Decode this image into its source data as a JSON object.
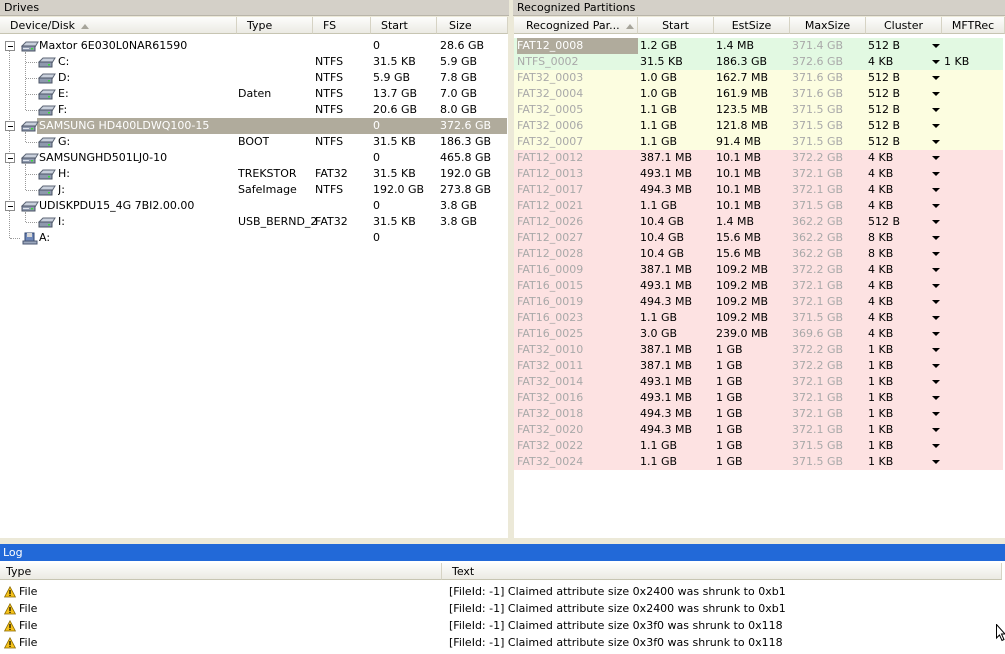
{
  "drives_panel": {
    "title": "Drives",
    "columns": [
      "Device/Disk",
      "Type",
      "FS",
      "Start",
      "Size"
    ],
    "rows": [
      {
        "level": 0,
        "name": "Maxtor 6E030L0NAR61590",
        "type": "",
        "fs": "",
        "start": "0",
        "size": "28.6 GB",
        "kind": "disk",
        "selected": false
      },
      {
        "level": 1,
        "name": "C:",
        "type": "",
        "fs": "NTFS",
        "start": "31.5 KB",
        "size": "5.9 GB",
        "kind": "part",
        "selected": false
      },
      {
        "level": 1,
        "name": "D:",
        "type": "",
        "fs": "NTFS",
        "start": "5.9 GB",
        "size": "7.8 GB",
        "kind": "part",
        "selected": false
      },
      {
        "level": 1,
        "name": "E:",
        "type": "Daten",
        "fs": "NTFS",
        "start": "13.7 GB",
        "size": "7.0 GB",
        "kind": "part",
        "selected": false
      },
      {
        "level": 1,
        "name": "F:",
        "type": "",
        "fs": "NTFS",
        "start": "20.6 GB",
        "size": "8.0 GB",
        "kind": "part",
        "selected": false
      },
      {
        "level": 0,
        "name": "SAMSUNG HD400LDWQ100-15",
        "type": "",
        "fs": "",
        "start": "0",
        "size": "372.6 GB",
        "kind": "disk",
        "selected": true
      },
      {
        "level": 1,
        "name": "G:",
        "type": "BOOT",
        "fs": "NTFS",
        "start": "31.5 KB",
        "size": "186.3 GB",
        "kind": "part",
        "selected": false
      },
      {
        "level": 0,
        "name": "SAMSUNGHD501LJ0-10",
        "type": "",
        "fs": "",
        "start": "0",
        "size": "465.8 GB",
        "kind": "disk",
        "selected": false
      },
      {
        "level": 1,
        "name": "H:",
        "type": "TREKSTOR",
        "fs": "FAT32",
        "start": "31.5 KB",
        "size": "192.0 GB",
        "kind": "part",
        "selected": false
      },
      {
        "level": 1,
        "name": "J:",
        "type": "SafeImage",
        "fs": "NTFS",
        "start": "192.0 GB",
        "size": "273.8 GB",
        "kind": "part",
        "selected": false
      },
      {
        "level": 0,
        "name": "UDISKPDU15_4G 7BI2.00.00",
        "type": "",
        "fs": "",
        "start": "0",
        "size": "3.8 GB",
        "kind": "disk",
        "selected": false
      },
      {
        "level": 1,
        "name": "I:",
        "type": "USB_BERND_2",
        "fs": "FAT32",
        "start": "31.5 KB",
        "size": "3.8 GB",
        "kind": "part",
        "selected": false
      },
      {
        "level": 0,
        "name": "A:",
        "type": "",
        "fs": "",
        "start": "0",
        "size": "",
        "kind": "floppy",
        "selected": false
      }
    ]
  },
  "partitions_panel": {
    "title": "Recognized Partitions",
    "columns": [
      "Recognized Par...",
      "Start",
      "EstSize",
      "MaxSize",
      "Cluster",
      "MFTRec"
    ],
    "colors": {
      "green": "#e2f9e2",
      "yellow": "#fcfde0",
      "red": "#fde2e2",
      "selected": "#b0ab9c"
    },
    "rows": [
      {
        "name": "FAT12_0008",
        "start": "1.2 GB",
        "est": "1.4 MB",
        "max": "371.4 GB",
        "cluster": "512 B",
        "mft": "",
        "color": "green",
        "selected": true
      },
      {
        "name": "NTFS_0002",
        "start": "31.5 KB",
        "est": "186.3 GB",
        "max": "372.6 GB",
        "cluster": "4 KB",
        "mft": "1 KB",
        "color": "green",
        "selected": false
      },
      {
        "name": "FAT32_0003",
        "start": "1.0 GB",
        "est": "162.7 MB",
        "max": "371.6 GB",
        "cluster": "512 B",
        "mft": "",
        "color": "yellow",
        "selected": false
      },
      {
        "name": "FAT32_0004",
        "start": "1.0 GB",
        "est": "161.9 MB",
        "max": "371.6 GB",
        "cluster": "512 B",
        "mft": "",
        "color": "yellow",
        "selected": false
      },
      {
        "name": "FAT32_0005",
        "start": "1.1 GB",
        "est": "123.5 MB",
        "max": "371.5 GB",
        "cluster": "512 B",
        "mft": "",
        "color": "yellow",
        "selected": false
      },
      {
        "name": "FAT32_0006",
        "start": "1.1 GB",
        "est": "121.8 MB",
        "max": "371.5 GB",
        "cluster": "512 B",
        "mft": "",
        "color": "yellow",
        "selected": false
      },
      {
        "name": "FAT32_0007",
        "start": "1.1 GB",
        "est": "91.4 MB",
        "max": "371.5 GB",
        "cluster": "512 B",
        "mft": "",
        "color": "yellow",
        "selected": false
      },
      {
        "name": "FAT12_0012",
        "start": "387.1 MB",
        "est": "10.1 MB",
        "max": "372.2 GB",
        "cluster": "4 KB",
        "mft": "",
        "color": "red",
        "selected": false
      },
      {
        "name": "FAT12_0013",
        "start": "493.1 MB",
        "est": "10.1 MB",
        "max": "372.1 GB",
        "cluster": "4 KB",
        "mft": "",
        "color": "red",
        "selected": false
      },
      {
        "name": "FAT12_0017",
        "start": "494.3 MB",
        "est": "10.1 MB",
        "max": "372.1 GB",
        "cluster": "4 KB",
        "mft": "",
        "color": "red",
        "selected": false
      },
      {
        "name": "FAT12_0021",
        "start": "1.1 GB",
        "est": "10.1 MB",
        "max": "371.5 GB",
        "cluster": "4 KB",
        "mft": "",
        "color": "red",
        "selected": false
      },
      {
        "name": "FAT12_0026",
        "start": "10.4 GB",
        "est": "1.4 MB",
        "max": "362.2 GB",
        "cluster": "512 B",
        "mft": "",
        "color": "red",
        "selected": false
      },
      {
        "name": "FAT12_0027",
        "start": "10.4 GB",
        "est": "15.6 MB",
        "max": "362.2 GB",
        "cluster": "8 KB",
        "mft": "",
        "color": "red",
        "selected": false
      },
      {
        "name": "FAT12_0028",
        "start": "10.4 GB",
        "est": "15.6 MB",
        "max": "362.2 GB",
        "cluster": "8 KB",
        "mft": "",
        "color": "red",
        "selected": false
      },
      {
        "name": "FAT16_0009",
        "start": "387.1 MB",
        "est": "109.2 MB",
        "max": "372.2 GB",
        "cluster": "4 KB",
        "mft": "",
        "color": "red",
        "selected": false
      },
      {
        "name": "FAT16_0015",
        "start": "493.1 MB",
        "est": "109.2 MB",
        "max": "372.1 GB",
        "cluster": "4 KB",
        "mft": "",
        "color": "red",
        "selected": false
      },
      {
        "name": "FAT16_0019",
        "start": "494.3 MB",
        "est": "109.2 MB",
        "max": "372.1 GB",
        "cluster": "4 KB",
        "mft": "",
        "color": "red",
        "selected": false
      },
      {
        "name": "FAT16_0023",
        "start": "1.1 GB",
        "est": "109.2 MB",
        "max": "371.5 GB",
        "cluster": "4 KB",
        "mft": "",
        "color": "red",
        "selected": false
      },
      {
        "name": "FAT16_0025",
        "start": "3.0 GB",
        "est": "239.0 MB",
        "max": "369.6 GB",
        "cluster": "4 KB",
        "mft": "",
        "color": "red",
        "selected": false
      },
      {
        "name": "FAT32_0010",
        "start": "387.1 MB",
        "est": "1 GB",
        "max": "372.2 GB",
        "cluster": "1 KB",
        "mft": "",
        "color": "red",
        "selected": false
      },
      {
        "name": "FAT32_0011",
        "start": "387.1 MB",
        "est": "1 GB",
        "max": "372.2 GB",
        "cluster": "1 KB",
        "mft": "",
        "color": "red",
        "selected": false
      },
      {
        "name": "FAT32_0014",
        "start": "493.1 MB",
        "est": "1 GB",
        "max": "372.1 GB",
        "cluster": "1 KB",
        "mft": "",
        "color": "red",
        "selected": false
      },
      {
        "name": "FAT32_0016",
        "start": "493.1 MB",
        "est": "1 GB",
        "max": "372.1 GB",
        "cluster": "1 KB",
        "mft": "",
        "color": "red",
        "selected": false
      },
      {
        "name": "FAT32_0018",
        "start": "494.3 MB",
        "est": "1 GB",
        "max": "372.1 GB",
        "cluster": "1 KB",
        "mft": "",
        "color": "red",
        "selected": false
      },
      {
        "name": "FAT32_0020",
        "start": "494.3 MB",
        "est": "1 GB",
        "max": "372.1 GB",
        "cluster": "1 KB",
        "mft": "",
        "color": "red",
        "selected": false
      },
      {
        "name": "FAT32_0022",
        "start": "1.1 GB",
        "est": "1 GB",
        "max": "371.5 GB",
        "cluster": "1 KB",
        "mft": "",
        "color": "red",
        "selected": false
      },
      {
        "name": "FAT32_0024",
        "start": "1.1 GB",
        "est": "1 GB",
        "max": "371.5 GB",
        "cluster": "1 KB",
        "mft": "",
        "color": "red",
        "selected": false
      }
    ]
  },
  "log_panel": {
    "title": "Log",
    "columns": [
      "Type",
      "Text"
    ],
    "rows": [
      {
        "type": "File",
        "text": "[FileId: -1] Claimed attribute size 0x2400 was shrunk to 0xb1"
      },
      {
        "type": "File",
        "text": "[FileId: -1] Claimed attribute size 0x2400 was shrunk to 0xb1"
      },
      {
        "type": "File",
        "text": "[FileId: -1] Claimed attribute size 0x3f0 was shrunk to 0x118"
      },
      {
        "type": "File",
        "text": "[FileId: -1] Claimed attribute size 0x3f0 was shrunk to 0x118"
      }
    ]
  },
  "icons": {
    "disk": "hard-disk-icon",
    "partition": "partition-icon",
    "floppy": "floppy-drive-icon",
    "warning": "warning-icon",
    "dropdown": "dropdown-arrow-icon"
  }
}
